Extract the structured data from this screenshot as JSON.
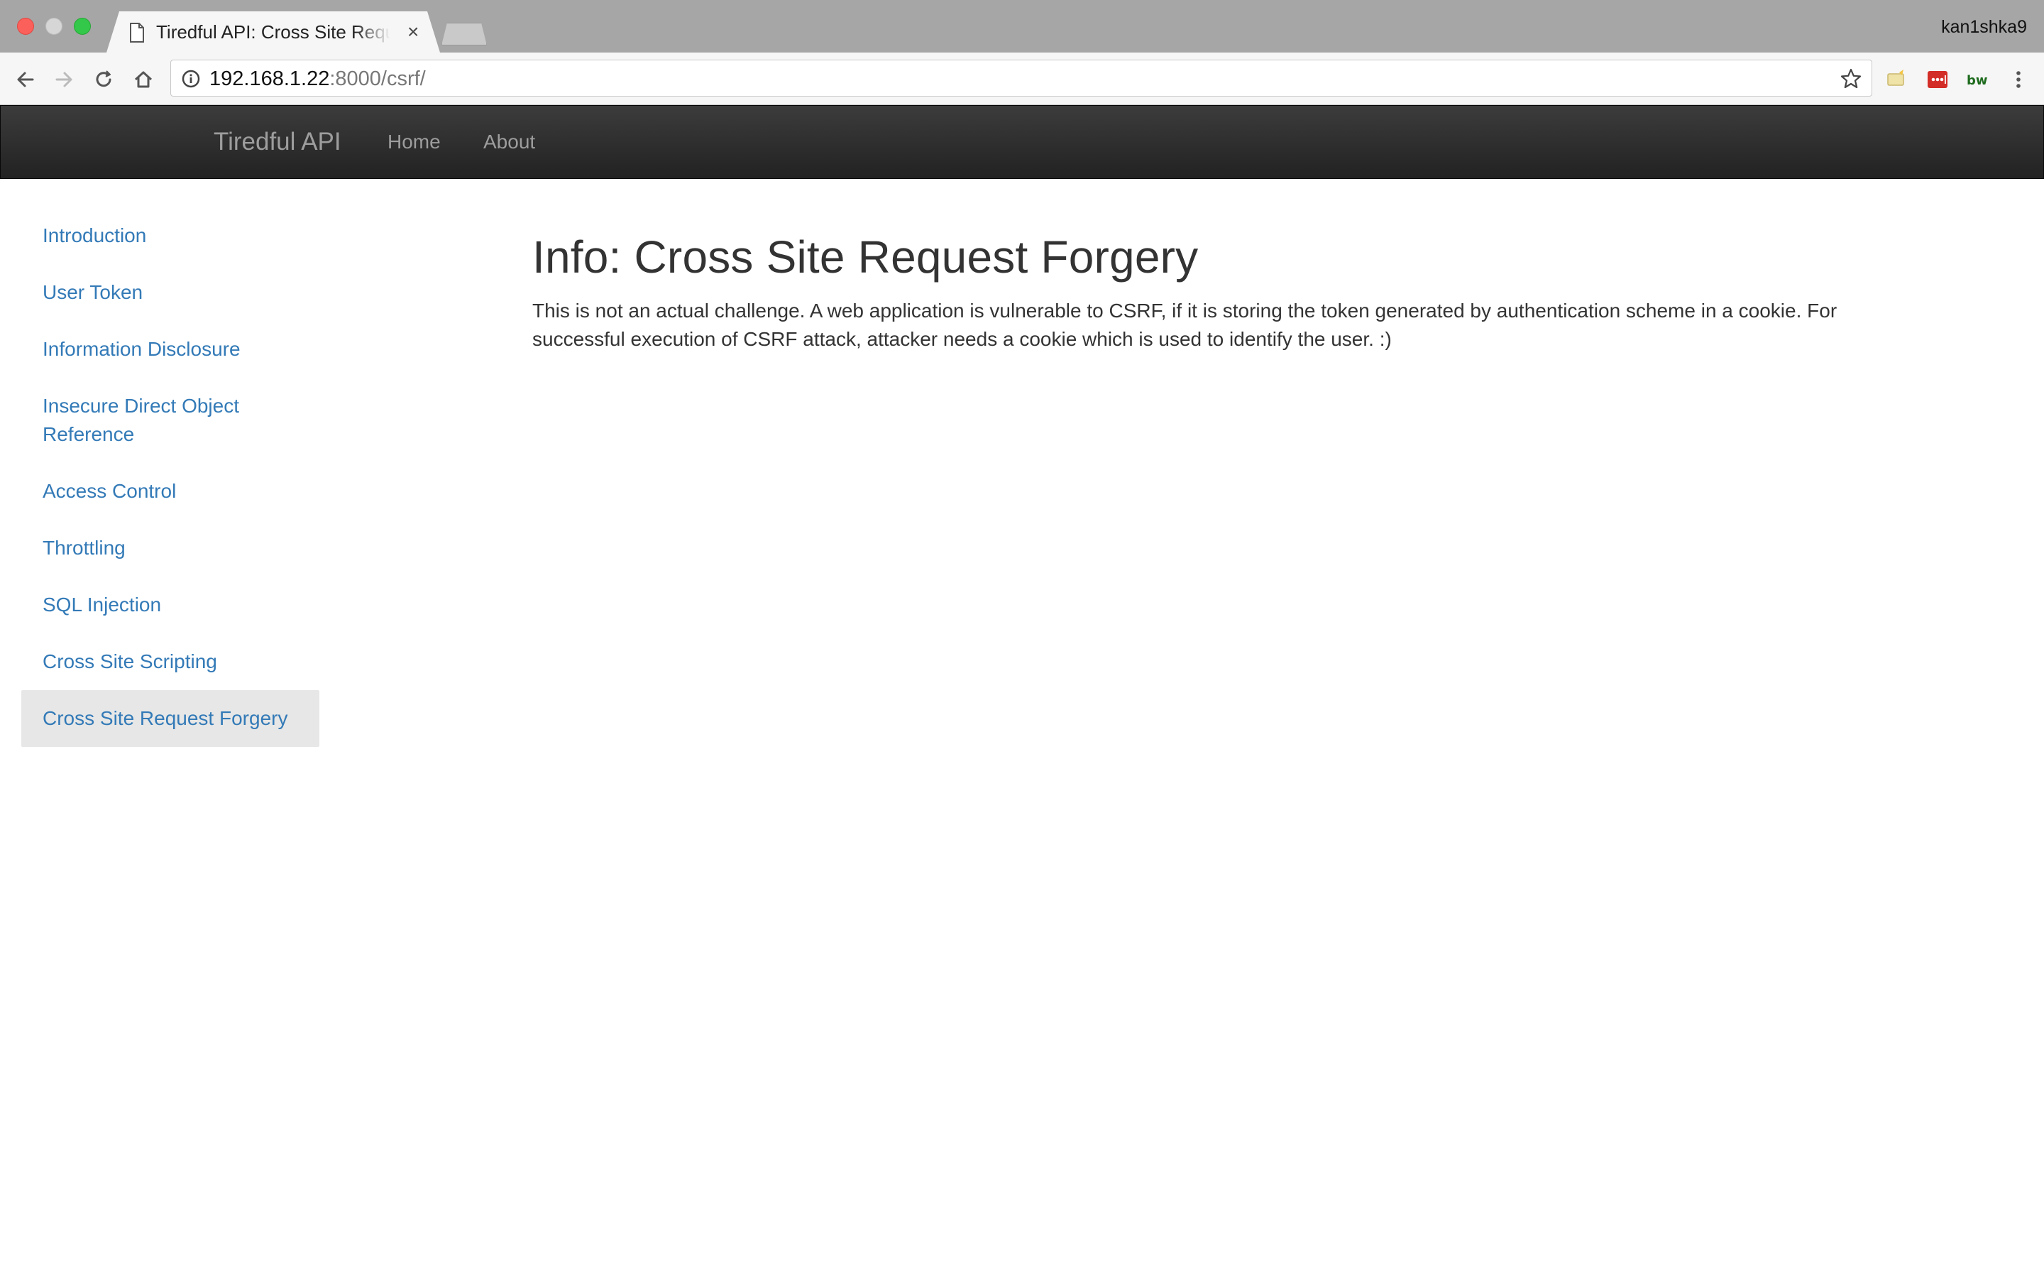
{
  "browser": {
    "tab_title": "Tiredful API: Cross Site Request Forgery",
    "tab_close": "×",
    "profile": "kan1shka9",
    "url_host": "192.168.1.22",
    "url_rest": ":8000/csrf/"
  },
  "navbar": {
    "brand": "Tiredful API",
    "links": [
      "Home",
      "About"
    ]
  },
  "sidebar": {
    "items": [
      {
        "label": "Introduction"
      },
      {
        "label": "User Token"
      },
      {
        "label": "Information Disclosure"
      },
      {
        "label": "Insecure Direct Object Reference"
      },
      {
        "label": "Access Control"
      },
      {
        "label": "Throttling"
      },
      {
        "label": "SQL Injection"
      },
      {
        "label": "Cross Site Scripting"
      },
      {
        "label": "Cross Site Request Forgery",
        "active": true
      }
    ]
  },
  "main": {
    "title": "Info: Cross Site Request Forgery",
    "paragraph": "This is not an actual challenge. A web application is vulnerable to CSRF, if it is storing the token generated by authentication scheme in a cookie. For successful execution of CSRF attack, attacker needs a cookie which is used to identify the user. :)"
  },
  "colors": {
    "link": "#337ab7",
    "navbar": "#222222",
    "active_item_bg": "#e7e7e7"
  }
}
